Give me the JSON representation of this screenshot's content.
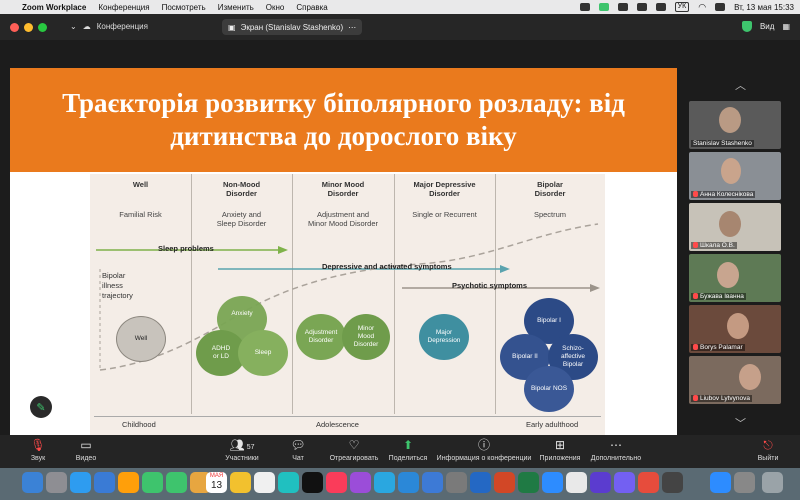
{
  "menubar": {
    "apple": "",
    "items": [
      "Zoom Workplace",
      "Конференция",
      "Посмотреть",
      "Изменить",
      "Окно",
      "Справка"
    ],
    "kbd": "УК",
    "datetime": "Вт, 13 мая  15:33"
  },
  "titlebar": {
    "conference": "Конференция",
    "screen_share": "Экран (Stanislav Stashenko)",
    "view": "Вид"
  },
  "slide": {
    "title_line1": "Траєкторія розвитку біполярного розладу: від",
    "title_line2": "дитинства до дорослого віку"
  },
  "figure": {
    "columns": [
      {
        "head": "Well",
        "sub": "Familial Risk"
      },
      {
        "head": "Non-Mood\nDisorder",
        "sub": "Anxiety and\nSleep Disorder"
      },
      {
        "head": "Minor Mood\nDisorder",
        "sub": "Adjustment and\nMinor Mood Disorder"
      },
      {
        "head": "Major Depressive\nDisorder",
        "sub": "Single or Recurrent"
      },
      {
        "head": "Bipolar\nDisorder",
        "sub": "Spectrum"
      }
    ],
    "arrows": {
      "sleep": "Sleep problems",
      "depressive": "Depressive and activated symptoms",
      "psychotic": "Psychotic symptoms"
    },
    "trajectory": "Bipolar\nillness\ntrajectory",
    "circles": {
      "well": "Well",
      "anxiety": "Anxiety",
      "adhd": "ADHD\nor LD",
      "sleep": "Sleep",
      "adjustment": "Adjustment\nDisorder",
      "minor_mood": "Minor\nMood\nDisorder",
      "major_depression": "Major\nDepression",
      "bipolar1": "Bipolar I",
      "bipolar2": "Bipolar II",
      "schizo": "Schizo-\naffective\nBipolar",
      "bipolar_nos": "Bipolar NOS"
    },
    "ages": {
      "childhood": "Childhood",
      "adolescence": "Adolescence",
      "adulthood": "Early adulthood"
    },
    "colors": {
      "green": "#7aa654",
      "teal": "#3f8fa0",
      "navy": "#2c4a86",
      "arrow_green": "#7fb24a",
      "arrow_teal": "#5aa3ae",
      "arrow_gray": "#9c948b"
    }
  },
  "participants": [
    {
      "name": "Stanislav Stashenko",
      "muted": false
    },
    {
      "name": "Анна Колеснікова",
      "muted": true
    },
    {
      "name": "Шкала О.В.",
      "muted": true
    },
    {
      "name": "Бужава Іванна",
      "muted": true
    },
    {
      "name": "Borys Palamar",
      "muted": true
    },
    {
      "name": "Liubov Lytvynova",
      "muted": true
    }
  ],
  "toolbar": {
    "audio": "Звук",
    "video": "Видео",
    "participants": "Участники",
    "participants_count": "57",
    "chat": "Чат",
    "react": "Отреагировать",
    "share": "Поделиться",
    "info": "Информация о конференции",
    "apps": "Приложения",
    "more": "Дополнительно",
    "leave": "Выйти"
  },
  "dock": {
    "calendar_month": "МАЯ",
    "calendar_day": "13"
  }
}
